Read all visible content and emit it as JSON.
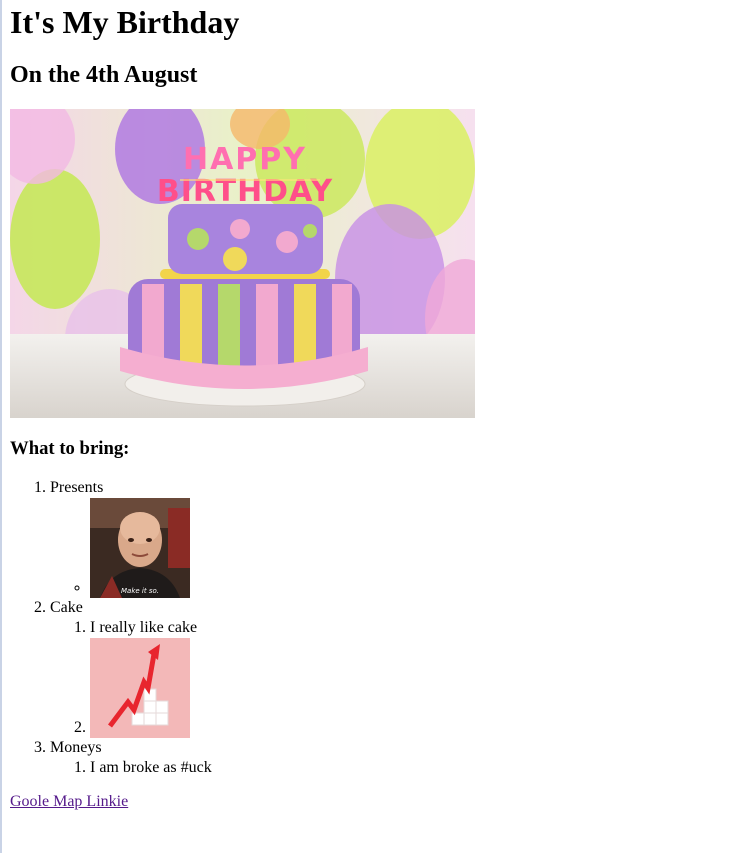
{
  "page": {
    "title": "It's My Birthday",
    "subtitle": "On the 4th August",
    "hero_image_text": "HAPPY BIRTHDAY",
    "bring_heading": "What to bring:",
    "items": [
      {
        "label": "Presents",
        "caption": "Make it so."
      },
      {
        "label": "Cake",
        "sub": "I really like cake"
      },
      {
        "label": "Moneys",
        "sub": "I am broke as #uck"
      }
    ],
    "map_link": "Goole Map Linkie"
  },
  "colors": {
    "link_visited": "#551a8b",
    "cake_purple": "#a07ad6",
    "chart_background": "#f3b8b8",
    "arrow_red": "#e8252e"
  }
}
